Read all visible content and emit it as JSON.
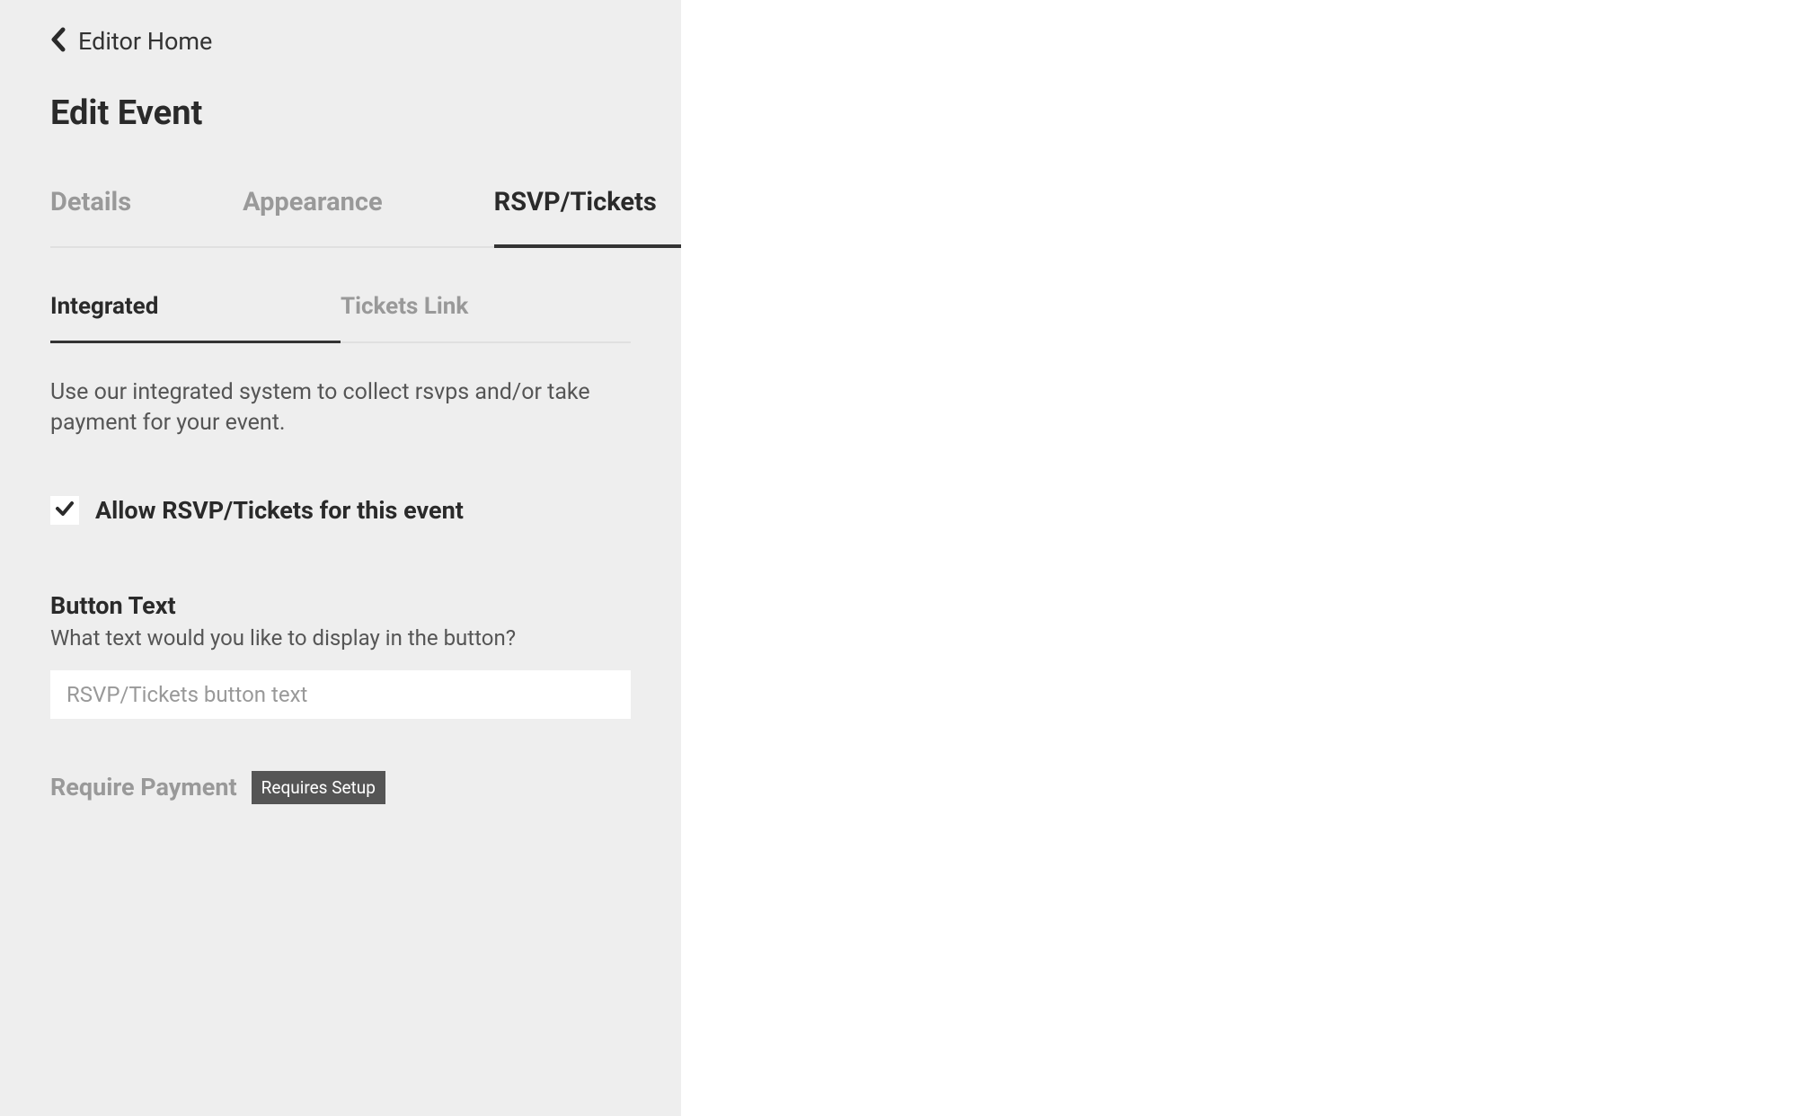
{
  "header": {
    "back_label": "Editor Home",
    "page_title": "Edit Event"
  },
  "main_tabs": {
    "details": "Details",
    "appearance": "Appearance",
    "rsvp": "RSVP/Tickets"
  },
  "sub_tabs": {
    "integrated": "Integrated",
    "tickets_link": "Tickets Link"
  },
  "description_text": "Use our integrated system to collect rsvps and/or take payment for your event.",
  "allow_checkbox": {
    "label": "Allow RSVP/Tickets for this event",
    "checked": true
  },
  "button_text_section": {
    "heading": "Button Text",
    "sub": "What text would you like to display in the button?",
    "placeholder": "RSVP/Tickets button text",
    "value": ""
  },
  "require_payment": {
    "label": "Require Payment",
    "badge": "Requires Setup"
  }
}
